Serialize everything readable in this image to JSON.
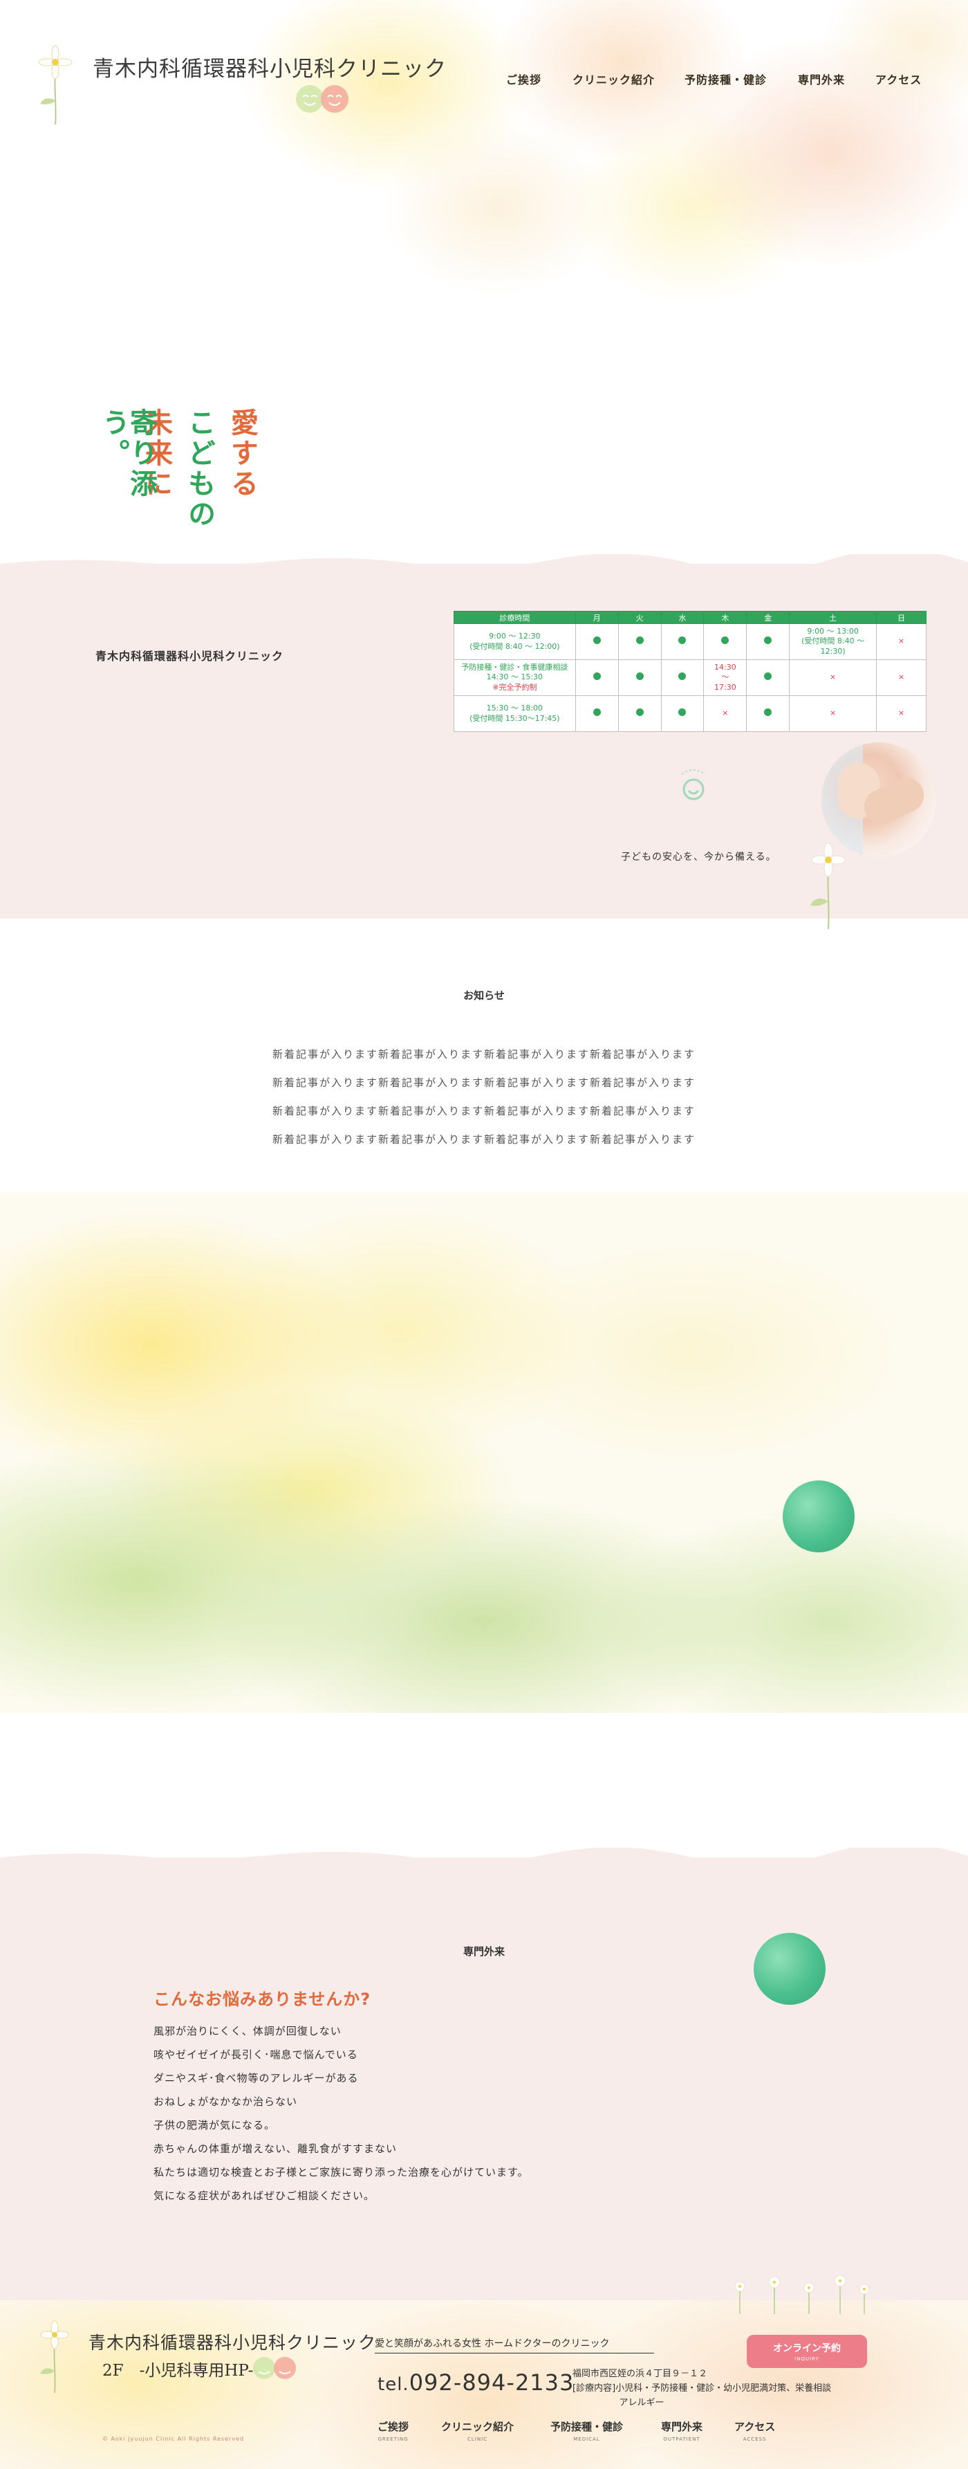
{
  "header": {
    "clinic_name": "青木内科循環器科小児科クリニック",
    "nav": [
      "ご挨拶",
      "クリニック紹介",
      "予防接種・健診",
      "専門外来",
      "アクセス"
    ]
  },
  "tagline": {
    "col1": "愛する",
    "col2": "こどもの",
    "col3": "未来に",
    "col4": "寄り添う。"
  },
  "hours": {
    "clinic_name": "青木内科循環器科小児科クリニック",
    "table": {
      "headers": [
        "診療時間",
        "月",
        "火",
        "水",
        "木",
        "金",
        "土",
        "日"
      ],
      "rows": [
        {
          "time": "9:00 ～ 12:30",
          "time_sub": "(受付時間 8:40 ～ 12:00)",
          "cells": [
            "●",
            "●",
            "●",
            "●",
            "●"
          ],
          "sat": "9:00 ～ 13:00",
          "sat_sub": "(受付時間 8:40 ～ 12:30)",
          "sun": "×"
        },
        {
          "time": "予防接種・健診・食事健康相談",
          "time_sub": "14:30 ～ 15:30",
          "time_note": "※完全予約制",
          "cells": [
            "●",
            "●",
            "●"
          ],
          "thu": "14:30",
          "thu_mid": "～",
          "thu_end": "17:30",
          "fri": "●",
          "sat": "×",
          "sun": "×"
        },
        {
          "time": "15:30 ～ 18:00",
          "time_sub": "(受付時間 15:30～17:45)",
          "cells": [
            "●",
            "●",
            "●"
          ],
          "thu": "×",
          "fri": "●",
          "sat": "×",
          "sun": "×"
        }
      ]
    },
    "caption": "子どもの安心を、今から備える。"
  },
  "news": {
    "title": "お知らせ",
    "items": [
      "新着記事が入ります新着記事が入ります新着記事が入ります新着記事が入ります",
      "新着記事が入ります新着記事が入ります新着記事が入ります新着記事が入ります",
      "新着記事が入ります新着記事が入ります新着記事が入ります新着記事が入ります",
      "新着記事が入ります新着記事が入ります新着記事が入ります新着記事が入ります"
    ]
  },
  "specialty": {
    "title": "専門外来",
    "heading": "こんなお悩みありませんか?",
    "lines": [
      "風邪が治りにくく、体調が回復しない",
      "咳やゼイゼイが長引く･喘息で悩んでいる",
      "ダニやスギ･食べ物等のアレルギーがある",
      "おねしょがなかなか治らない",
      "子供の肥満が気になる。",
      "赤ちゃんの体重が増えない、離乳食がすすまない",
      "私たちは適切な検査とお子様とご家族に寄り添った治療を心がけています。",
      "気になる症状があればぜひご相談ください。"
    ]
  },
  "footer": {
    "clinic_name": "青木内科循環器科小児科クリニック",
    "sub": "2F　-小児科専用HP-",
    "tagline": "愛と笑顔があふれる女性 ホームドクターのクリニック",
    "tel_prefix": "tel.",
    "tel": "092-894-2133",
    "address": "福岡市西区姪の浜４丁目９－１２",
    "services": "[診療内容]小児科・予防接種・健診・幼小児肥満対策、栄養相談",
    "services2": "アレルギー",
    "reserve_label": "オンライン予約",
    "reserve_sub": "INQUIRY",
    "copyright": "© Aoki Jyuujun Clinic All Rights Reserved",
    "nav": [
      {
        "jp": "ご挨拶",
        "en": "GREETING"
      },
      {
        "jp": "クリニック紹介",
        "en": "CLINIC"
      },
      {
        "jp": "予防接種・健診",
        "en": "MEDICAL"
      },
      {
        "jp": "専門外来",
        "en": "OUTPATIENT"
      },
      {
        "jp": "アクセス",
        "en": "ACCESS"
      }
    ]
  },
  "colors": {
    "accent_green": "#2fa65a",
    "accent_red": "#d9404a",
    "accent_orange": "#e26a3a",
    "pink_bg": "#f7ecea",
    "reserve_pink": "#ee7d8a"
  }
}
